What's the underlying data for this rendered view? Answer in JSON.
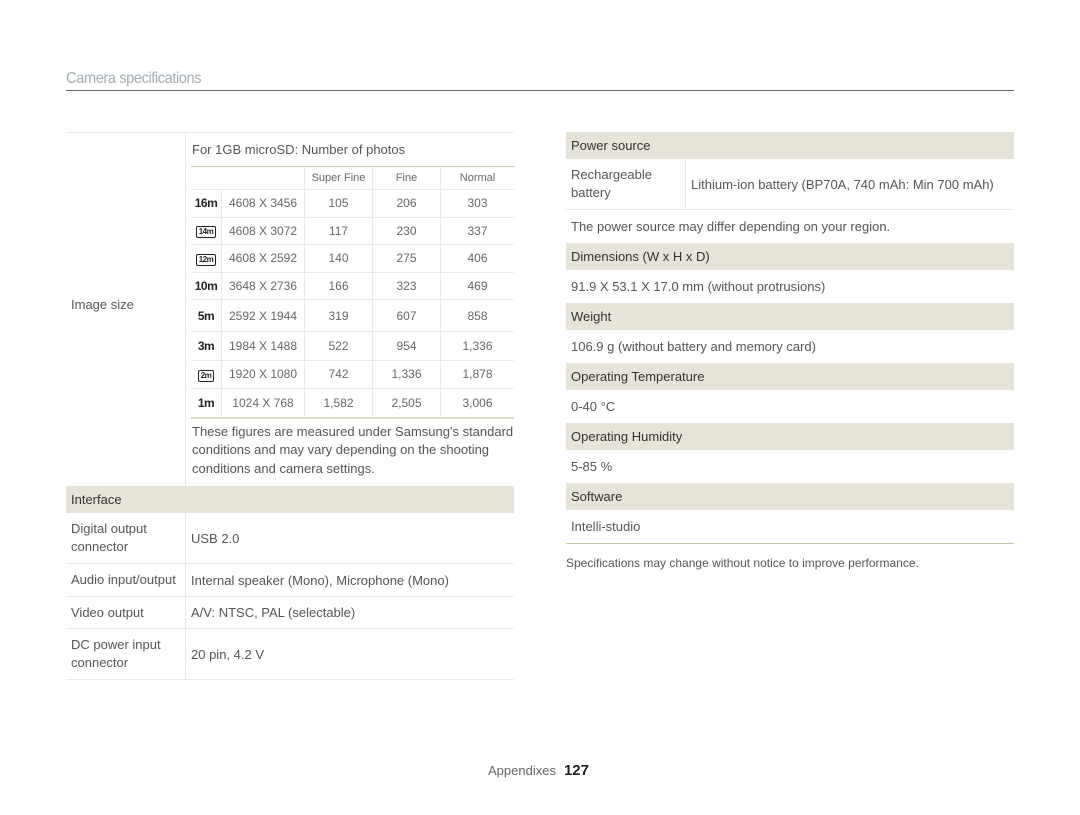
{
  "page": {
    "title": "Camera specifications",
    "footer_section": "Appendixes",
    "page_number": "127"
  },
  "image_size": {
    "label": "Image size",
    "caption": "For 1GB microSD: Number of photos",
    "columns": [
      "Super Fine",
      "Fine",
      "Normal"
    ],
    "rows": [
      {
        "icon": "16m-icon",
        "glyph": "16m",
        "resolution": "4608 X 3456",
        "super_fine": "105",
        "fine": "206",
        "normal": "303"
      },
      {
        "icon": "14m-wide-icon",
        "glyph": "14m",
        "resolution": "4608 X 3072",
        "super_fine": "117",
        "fine": "230",
        "normal": "337"
      },
      {
        "icon": "12m-wide-icon",
        "glyph": "12m",
        "resolution": "4608 X 2592",
        "super_fine": "140",
        "fine": "275",
        "normal": "406"
      },
      {
        "icon": "10m-icon",
        "glyph": "10m",
        "resolution": "3648 X 2736",
        "super_fine": "166",
        "fine": "323",
        "normal": "469"
      },
      {
        "icon": "5m-icon",
        "glyph": "5m",
        "resolution": "2592 X 1944",
        "super_fine": "319",
        "fine": "607",
        "normal": "858"
      },
      {
        "icon": "3m-icon",
        "glyph": "3m",
        "resolution": "1984 X 1488",
        "super_fine": "522",
        "fine": "954",
        "normal": "1,336"
      },
      {
        "icon": "2m-wide-icon",
        "glyph": "2m",
        "resolution": "1920 X 1080",
        "super_fine": "742",
        "fine": "1,336",
        "normal": "1,878"
      },
      {
        "icon": "1m-icon",
        "glyph": "1m",
        "resolution": "1024 X 768",
        "super_fine": "1,582",
        "fine": "2,505",
        "normal": "3,006"
      }
    ],
    "note": "These figures are measured under Samsung's standard conditions and may vary depending on the shooting conditions and camera settings."
  },
  "interface": {
    "heading": "Interface",
    "rows": [
      {
        "key": "Digital output connector",
        "value": "USB 2.0"
      },
      {
        "key": "Audio input/output",
        "value": "Internal speaker (Mono), Microphone (Mono)"
      },
      {
        "key": "Video output",
        "value": "A/V: NTSC, PAL (selectable)"
      },
      {
        "key": "DC power input connector",
        "value": "20 pin, 4.2 V"
      }
    ]
  },
  "power_source": {
    "heading": "Power source",
    "key": "Rechargeable battery",
    "value": "Lithium-ion battery (BP70A, 740 mAh: Min 700 mAh)",
    "note": "The power source may differ depending on your region."
  },
  "dimensions": {
    "heading": "Dimensions (W x H x D)",
    "value": "91.9 X 53.1 X 17.0 mm (without protrusions)"
  },
  "weight": {
    "heading": "Weight",
    "value": "106.9 g (without battery and memory card)"
  },
  "operating_temperature": {
    "heading": "Operating Temperature",
    "value": "0-40 °C"
  },
  "operating_humidity": {
    "heading": "Operating Humidity",
    "value": "5-85 %"
  },
  "software": {
    "heading": "Software",
    "value": "Intelli-studio"
  },
  "disclaimer": "Specifications may change without notice to improve performance."
}
